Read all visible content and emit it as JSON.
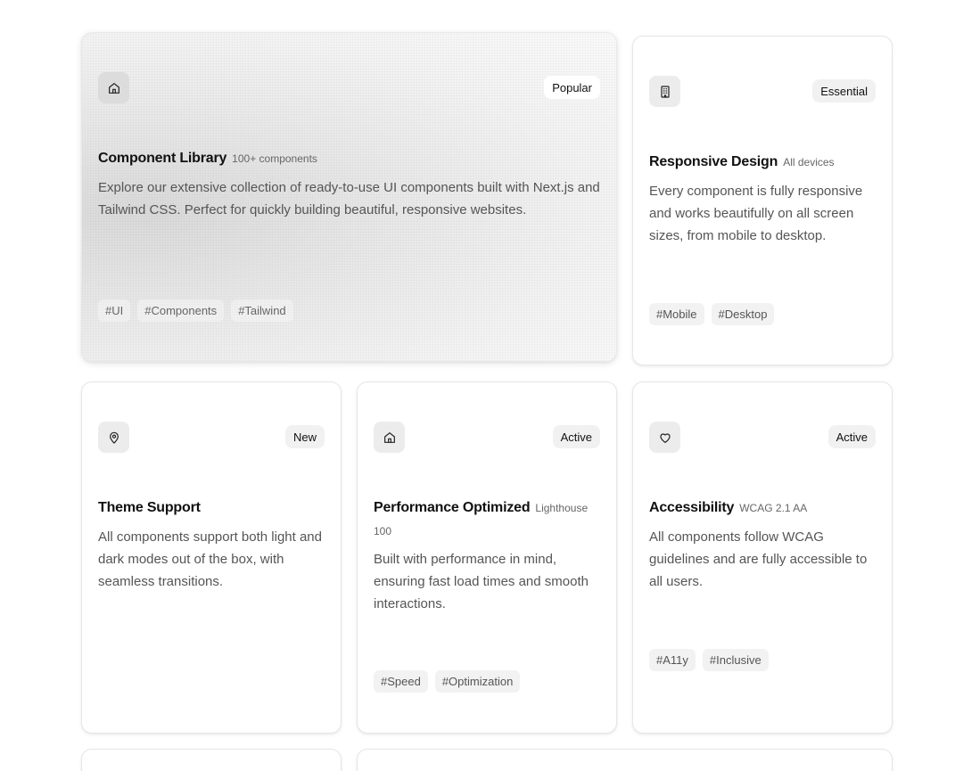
{
  "cards": [
    {
      "icon": "home-icon",
      "badge": "Popular",
      "title": "Component Library",
      "subtitle": "100+ components",
      "description": "Explore our extensive collection of ready-to-use UI components built with Next.js and Tailwind CSS. Perfect for quickly building beautiful, responsive websites.",
      "tags": [
        "#UI",
        "#Components",
        "#Tailwind"
      ]
    },
    {
      "icon": "building-icon",
      "badge": "Essential",
      "title": "Responsive Design",
      "subtitle": "All devices",
      "description": "Every component is fully responsive and works beautifully on all screen sizes, from mobile to desktop.",
      "tags": [
        "#Mobile",
        "#Desktop"
      ]
    },
    {
      "icon": "map-pin-icon",
      "badge": "New",
      "title": "Theme Support",
      "subtitle": "",
      "description": "All components support both light and dark modes out of the box, with seamless transitions.",
      "tags": []
    },
    {
      "icon": "home-icon",
      "badge": "Active",
      "title": "Performance Optimized",
      "subtitle": "Lighthouse 100",
      "description": "Built with performance in mind, ensuring fast load times and smooth interactions.",
      "tags": [
        "#Speed",
        "#Optimization"
      ]
    },
    {
      "icon": "heart-icon",
      "badge": "Active",
      "title": "Accessibility",
      "subtitle": "WCAG 2.1 AA",
      "description": "All components follow WCAG guidelines and are fully accessible to all users.",
      "tags": [
        "#A11y",
        "#Inclusive"
      ]
    }
  ]
}
